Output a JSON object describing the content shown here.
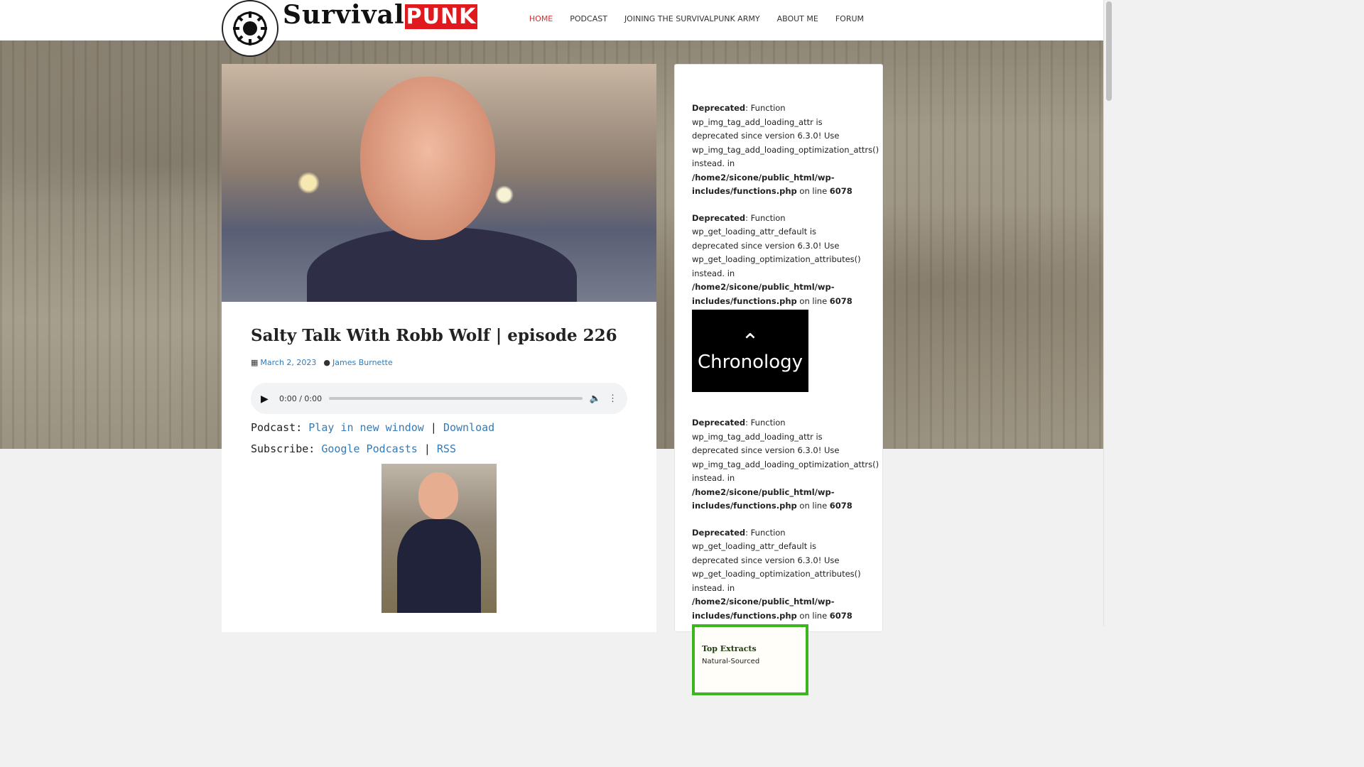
{
  "site": {
    "logo_prefix": "Survival",
    "logo_suffix": "PUNK"
  },
  "nav": {
    "items": [
      {
        "label": "HOME",
        "active": true
      },
      {
        "label": "PODCAST"
      },
      {
        "label": "JOINING THE SURVIVALPUNK ARMY"
      },
      {
        "label": "ABOUT ME"
      },
      {
        "label": "FORUM"
      }
    ]
  },
  "post": {
    "title": "Salty Talk With Robb Wolf | episode 226",
    "date": "March 2, 2023",
    "author": "James Burnette",
    "audio": {
      "time": "0:00 / 0:00"
    },
    "podcast_label": "Podcast:",
    "play_new_window": "Play in new window",
    "separator": "|",
    "download": "Download",
    "subscribe_label": "Subscribe:",
    "google_podcasts": "Google Podcasts",
    "rss": "RSS"
  },
  "sidebar": {
    "notices": [
      {
        "label": "Deprecated",
        "text": ": Function wp_img_tag_add_loading_attr is deprecated since version 6.3.0! Use wp_img_tag_add_loading_optimization_attrs() instead. in ",
        "path": "/home2/sicone/public_html/wp-includes/functions.php",
        "online": " on line ",
        "line": "6078"
      },
      {
        "label": "Deprecated",
        "text": ": Function wp_get_loading_attr_default is deprecated since version 6.3.0! Use wp_get_loading_optimization_attributes() instead. in ",
        "path": "/home2/sicone/public_html/wp-includes/functions.php",
        "online": " on line ",
        "line": "6078"
      },
      {
        "label": "Deprecated",
        "text": ": Function wp_img_tag_add_loading_attr is deprecated since version 6.3.0! Use wp_img_tag_add_loading_optimization_attrs() instead. in ",
        "path": "/home2/sicone/public_html/wp-includes/functions.php",
        "online": " on line ",
        "line": "6078"
      },
      {
        "label": "Deprecated",
        "text": ": Function wp_get_loading_attr_default is deprecated since version 6.3.0! Use wp_get_loading_optimization_attributes() instead. in ",
        "path": "/home2/sicone/public_html/wp-includes/functions.php",
        "online": " on line ",
        "line": "6078"
      }
    ],
    "chronology_ad": "Chronology",
    "topextracts_brand": "Top Extracts",
    "topextracts_sub": "Natural-Sourced"
  }
}
